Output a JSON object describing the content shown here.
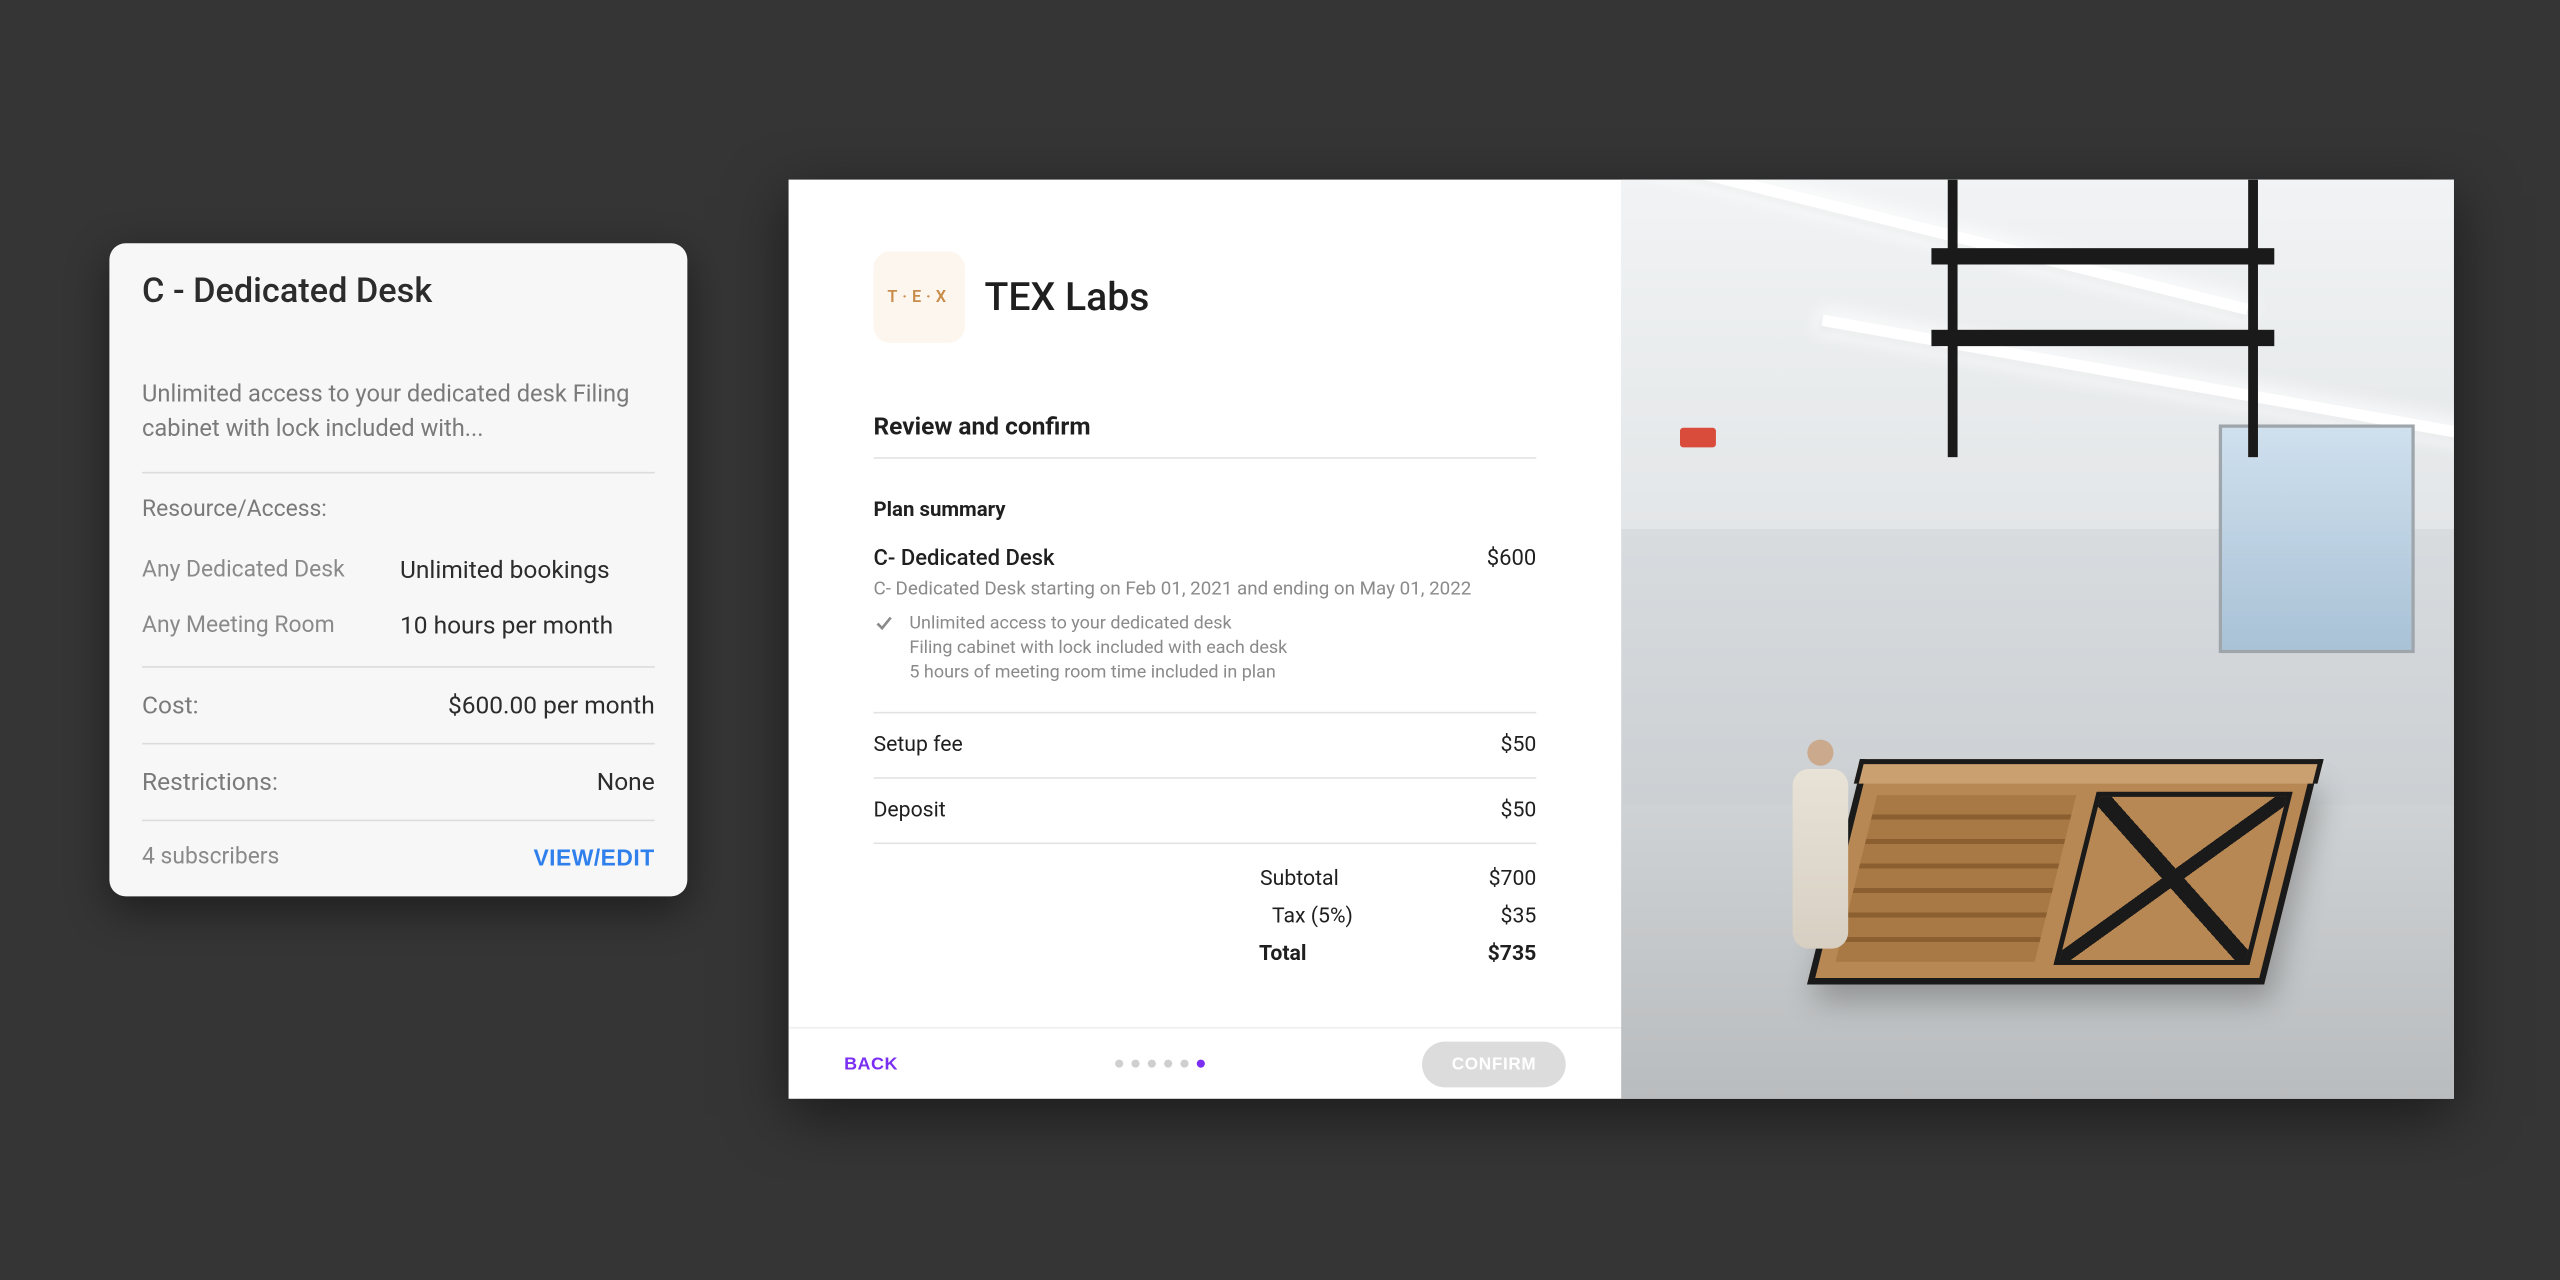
{
  "card": {
    "title": "C - Dedicated Desk",
    "description": "Unlimited access to your dedicated desk Filing cabinet with lock included with...",
    "resource_label": "Resource/Access:",
    "access": [
      {
        "name": "Any Dedicated Desk",
        "value": "Unlimited bookings"
      },
      {
        "name": "Any Meeting Room",
        "value": "10 hours per month"
      }
    ],
    "cost_label": "Cost:",
    "cost_value": "$600.00 per month",
    "restrictions_label": "Restrictions:",
    "restrictions_value": "None",
    "subscribers": "4 subscribers",
    "view_edit": "VIEW/EDIT"
  },
  "checkout": {
    "brand_badge": "T·E·X",
    "brand_name": "TEX Labs",
    "review_title": "Review and confirm",
    "summary_heading": "Plan summary",
    "plan_name": "C- Dedicated Desk",
    "plan_price": "$600",
    "plan_period": "C- Dedicated Desk starting on Feb 01, 2021 and ending on May 01, 2022",
    "features": [
      "Unlimited access to your dedicated desk",
      "Filing cabinet with lock included with each desk",
      "5 hours of meeting room time included in plan"
    ],
    "lines": [
      {
        "label": "Setup fee",
        "value": "$50"
      },
      {
        "label": "Deposit",
        "value": "$50"
      }
    ],
    "totals": [
      {
        "label": "Subtotal",
        "value": "$700",
        "bold": false
      },
      {
        "label": "Tax (5%)",
        "value": "$35",
        "bold": false
      },
      {
        "label": "Total",
        "value": "$735",
        "bold": true
      }
    ],
    "back": "BACK",
    "confirm": "CONFIRM",
    "step_count": 6,
    "step_active_index": 5
  }
}
